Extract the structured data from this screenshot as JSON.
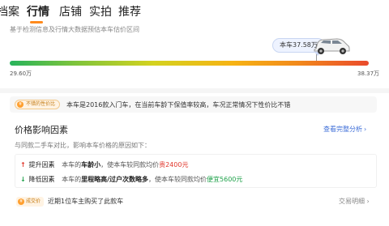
{
  "tabs": [
    {
      "label": "档案"
    },
    {
      "label": "行情"
    },
    {
      "label": "店铺"
    },
    {
      "label": "实拍"
    },
    {
      "label": "推荐"
    }
  ],
  "active_tab": "行情",
  "subtitle": "基于检测信息及行情大数据预估本车估价区间",
  "price": {
    "tag": "本车37.58万",
    "low": "29.60万",
    "high": "38.37万",
    "position_fraction": 0.89
  },
  "cost": {
    "badge": "不错的性价比",
    "text": "本车是2016款入门车，在当前车龄下保值率较高，车况正常情况下性价比不错"
  },
  "factors": {
    "title": "价格影响因素",
    "link": "查看完整分析",
    "desc": "与同款二手车对比，影响本车价格的原因如下：",
    "up": {
      "name": "提升因素",
      "pre": "本车的",
      "highlight": "车龄小",
      "mid": "，使本车较同款均价",
      "amount": "贵2400元"
    },
    "down": {
      "name": "降低因素",
      "pre": "本车的",
      "highlight": "里程略高/过户次数略多",
      "mid": "，使本车较同款均价",
      "amount": "便宜5600元"
    }
  },
  "deal": {
    "badge": "成交价",
    "text": "近期1位车主购买了此款车",
    "link": "交易明细"
  },
  "colors": {
    "accent": "#ff8a1c",
    "link": "#3f6fd8",
    "up": "#e0362b",
    "down": "#1fa14a"
  },
  "icons": {
    "up": "arrow-up-icon",
    "down": "arrow-down-icon",
    "cost": "coin-icon",
    "deal": "coin-icon",
    "chevron": "chevron-right-icon"
  }
}
